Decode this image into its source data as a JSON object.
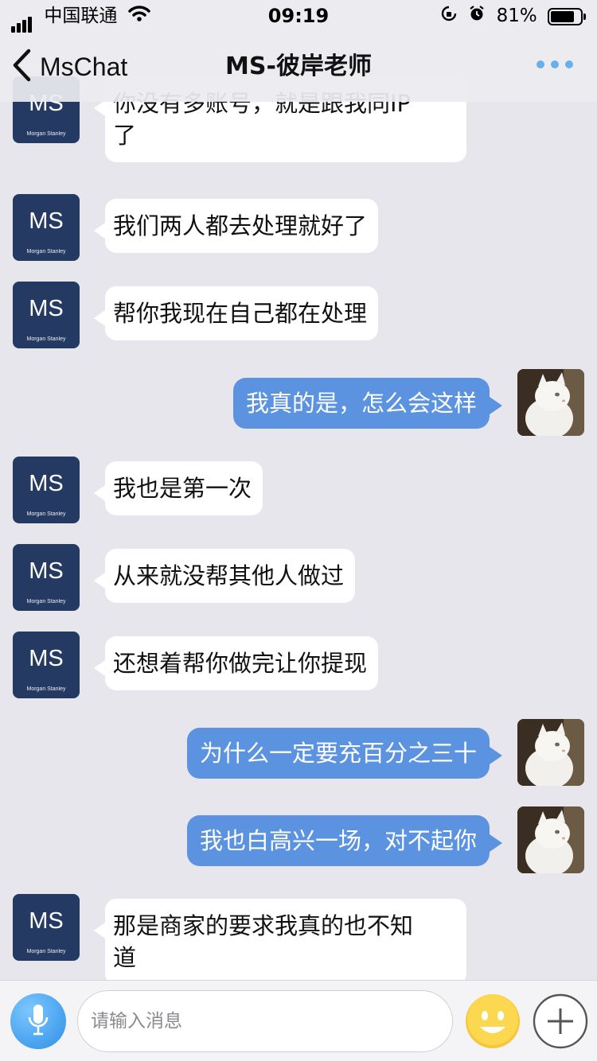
{
  "status_bar": {
    "carrier": "中国联通",
    "time": "09:19",
    "battery": "81%",
    "battery_level": 0.81
  },
  "nav": {
    "back_label": "MsChat",
    "title": "MS-彼岸老师"
  },
  "ms_avatar": {
    "text": "MS",
    "subtext": "Morgan Stanley",
    "color": "#253a63"
  },
  "colors": {
    "outgoing_bubble": "#5b93e1",
    "incoming_bubble": "#ffffff",
    "background": "#e6e6ec",
    "more_dots": "#68b0ec"
  },
  "messages": [
    {
      "side": "left",
      "text": "你没有多账号，就是跟我同IP\n了"
    },
    {
      "side": "left",
      "text": "我们两人都去处理就好了"
    },
    {
      "side": "left",
      "text": "帮你我现在自己都在处理"
    },
    {
      "side": "right",
      "text": "我真的是，怎么会这样"
    },
    {
      "side": "left",
      "text": "我也是第一次"
    },
    {
      "side": "left",
      "text": "从来就没帮其他人做过"
    },
    {
      "side": "left",
      "text": "还想着帮你做完让你提现"
    },
    {
      "side": "right",
      "text": "为什么一定要充百分之三十"
    },
    {
      "side": "right",
      "text": "我也白高兴一场，对不起你"
    },
    {
      "side": "left",
      "text": "那是商家的要求我真的也不知\n道"
    }
  ],
  "input": {
    "placeholder": "请输入消息"
  },
  "icons": {
    "voice": "microphone-icon",
    "emoji": "smiley-icon",
    "plus": "plus-icon",
    "back": "chevron-left-icon",
    "more": "more-dots-icon"
  }
}
